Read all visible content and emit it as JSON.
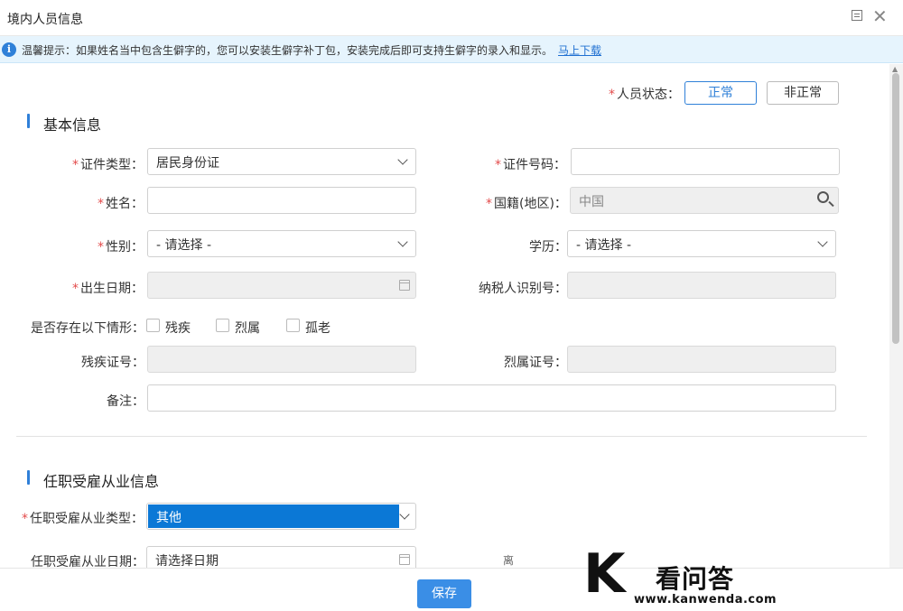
{
  "window": {
    "title": "境内人员信息"
  },
  "notice": {
    "text": "温馨提示：如果姓名当中包含生僻字的，您可以安装生僻字补丁包，安装完成后即可支持生僻字的录入和显示。",
    "link": "马上下载"
  },
  "status": {
    "label": "人员状态：",
    "active": "正常",
    "inactive": "非正常"
  },
  "basic": {
    "title": "基本信息",
    "id_type_label": "证件类型：",
    "id_type_value": "居民身份证",
    "id_number_label": "证件号码：",
    "id_number_value": "",
    "name_label": "姓名：",
    "name_value": "",
    "nationality_label": "国籍(地区)：",
    "nationality_value": "中国",
    "gender_label": "性别：",
    "gender_value": "- 请选择 -",
    "education_label": "学历：",
    "education_value": "- 请选择 -",
    "birth_label": "出生日期：",
    "birth_value": "",
    "taxid_label": "纳税人识别号：",
    "taxid_value": "",
    "situation_label": "是否存在以下情形：",
    "opt_disabled": "残疾",
    "opt_martyr": "烈属",
    "opt_elderly": "孤老",
    "disability_no_label": "残疾证号：",
    "martyr_no_label": "烈属证号：",
    "remark_label": "备注：",
    "remark_value": ""
  },
  "employment": {
    "title": "任职受雇从业信息",
    "type_label": "任职受雇从业类型：",
    "type_value": "其他",
    "date_label": "任职受雇从业日期：",
    "date_placeholder": "请选择日期",
    "partial_label": "离"
  },
  "footer": {
    "save": "保存"
  },
  "watermark": {
    "cn": "看问答",
    "url": "www.kanwenda.com"
  }
}
